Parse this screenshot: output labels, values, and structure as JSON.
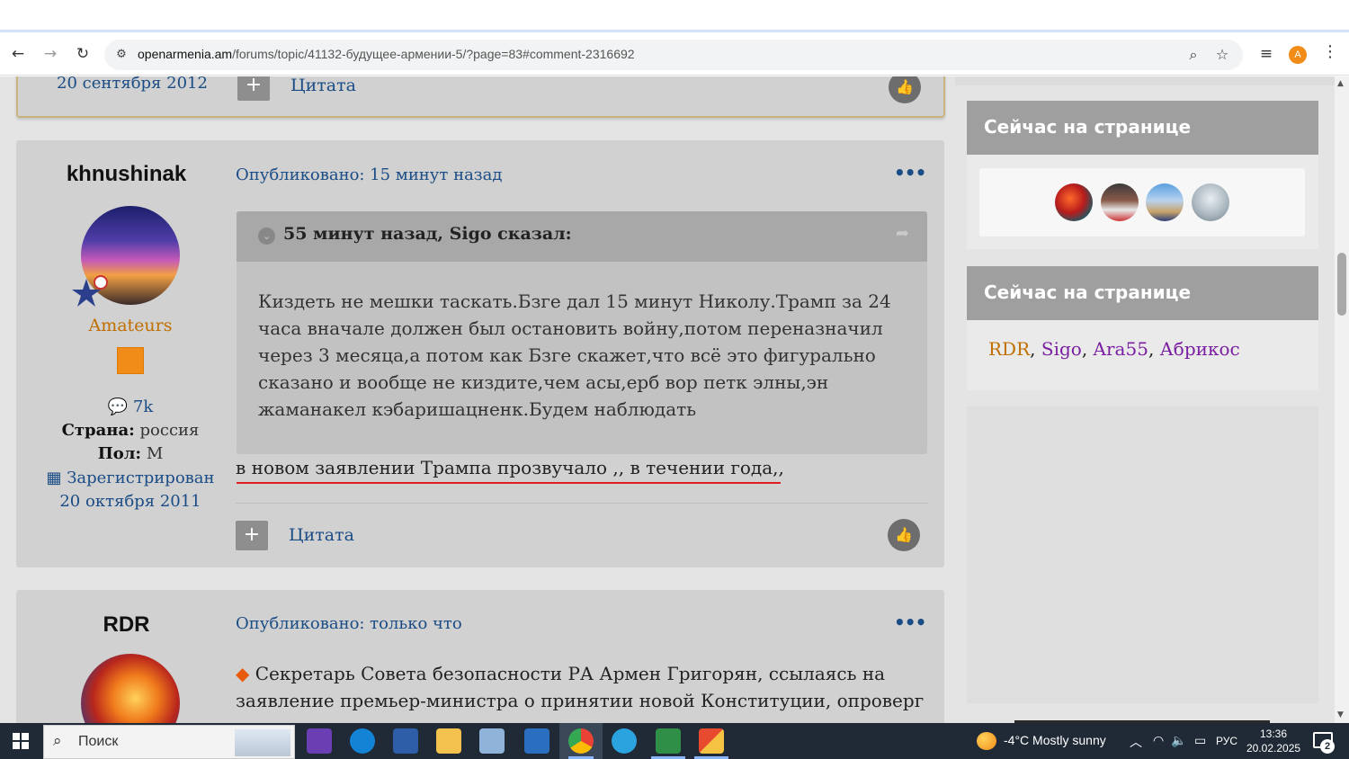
{
  "browser": {
    "url_host": "openarmenia.am",
    "url_path": "/forums/topic/41132-будущее-армении-5/?page=83#comment-2316692",
    "profile_initial": "A"
  },
  "prev_post": {
    "date": "20 сентября 2012",
    "quote_label": "Цитата"
  },
  "post1": {
    "author": "khnushinak",
    "posted": "Опубликовано: 15 минут назад",
    "rank": "Amateurs",
    "posts_count": "7k",
    "country_label": "Страна:",
    "country": "россия",
    "gender_label": "Пол:",
    "gender": "М",
    "registered_label": "Зарегистрирован",
    "registered_date": "20 октября 2011",
    "quote_header": "55 минут назад, Sigo сказал:",
    "quote_text": "Киздеть не мешки таскать.Бзге дал 15 минут Николу.Трамп за 24 часа вначале должен был остановить войну,потом переназначил через 3 месяца,а потом как Бзге скажет,что всё это фигурально сказано и вообще не киздите,чем асы,ерб вор петк элны,эн жаманакел кэбаришацненк.Будем наблюдать",
    "body": "в новом заявлении Трампа прозвучало ,, в течении года,,",
    "quote_label": "Цитата"
  },
  "post2": {
    "author": "RDR",
    "posted": "Опубликовано: только что",
    "body": "Секретарь Совета безопасности РА Армен Григорян, ссылаясь на заявление премьер-министра о принятии новой Конституции, опроверг"
  },
  "sidebar": {
    "panel1_title": "Сейчас на странице",
    "panel2_title": "Сейчас на странице",
    "online_users": [
      {
        "name": "RDR",
        "color": "#c06f00"
      },
      {
        "name": "Sigo",
        "color": "#7a1fa2"
      },
      {
        "name": "Ara55",
        "color": "#7a1fa2"
      },
      {
        "name": "Абрикос",
        "color": "#7a1fa2"
      }
    ]
  },
  "taskbar": {
    "search_label": "Поиск",
    "weather": "-4°C  Mostly sunny",
    "language": "РУС",
    "time": "13:36",
    "date": "20.02.2025",
    "notifications": "2"
  },
  "icons": [
    "back-icon",
    "forward-icon",
    "reload-icon",
    "site-info-icon",
    "zoom-icon",
    "bookmark-star-icon",
    "reading-list-icon",
    "menu-icon",
    "like-icon",
    "comment-icon",
    "calendar-icon",
    "share-icon",
    "windows-start-icon",
    "search-icon"
  ]
}
